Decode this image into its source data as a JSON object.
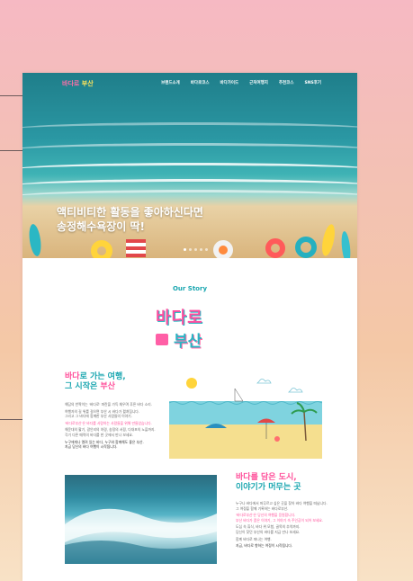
{
  "hero": {
    "logo_part1": "바다로",
    "logo_part2": "부산",
    "menu": [
      "브랜드소개",
      "바다로코스",
      "바다가이드",
      "근처여행지",
      "추천코스",
      "SNS후기"
    ],
    "headline": "액티비티한 활동을 좋아하신다면\n송정해수욕장이 딱!",
    "slides": 5,
    "active_slide": 1
  },
  "story": {
    "title": "Our Story",
    "logo_line1": "바다로",
    "logo_line2": "부산"
  },
  "section1": {
    "title_line1_pink": "바다",
    "title_line1_rest": "로 가는 여행,",
    "title_line2_rest": "그 시작은 ",
    "title_line2_pink": "부산",
    "paragraphs": [
      "해답의 반짝이는 '바다로' 파란을 가득 채우며 푸른 바다 소리.",
      "여행자의 길 위를 걸으면 부산 시 바다가 펼쳐집니다.",
      "그리고 그 바다에 함께한 부산 사람들의 이야기.",
      "'바다로부산'은 바다를 사랑하는 사람들을 위해 만들었습니다.",
      "해운대의 활기, 광안리의 야경, 송정의 서핑, 다대포의 노을까지.",
      "각기 다른 매력의 바다를 한 곳에서 만나 보세요.",
      "누구에게나 열려 있는 바다, 누구와 함께해도 좋은 부산.",
      "지금 당신의 바다 여행이 시작됩니다."
    ]
  },
  "section2": {
    "title_line1_pink": "바다",
    "title_line1_rest": "를 담은 도시,",
    "title_line2": "이야기가 머무는 곳",
    "paragraphs": [
      "누구나 바다에서 머무르고 싶은 곳을 찾아 바다 여행을 떠납니다.",
      "그 여정을 함께 기록하는 바다로부산.",
      "'바다로부산'은 당신의 여행을 응원합니다.",
      "부산 바다가 품은 이야기, 그 이야기 속 주인공이 되어 보세요.",
      "도심 속 휴식, 바다 위 모험, 골목의 추억까지.",
      "당신이 찾던 부산의 바다를 지금 만나 보세요.",
      "함께 바다로 떠나는 여행.",
      "지금, 바다로 향하는 여정이 시작됩니다."
    ]
  },
  "colors": {
    "teal": "#1aa6b0",
    "pink": "#ff4f9a",
    "yellow": "#ffe45a"
  }
}
